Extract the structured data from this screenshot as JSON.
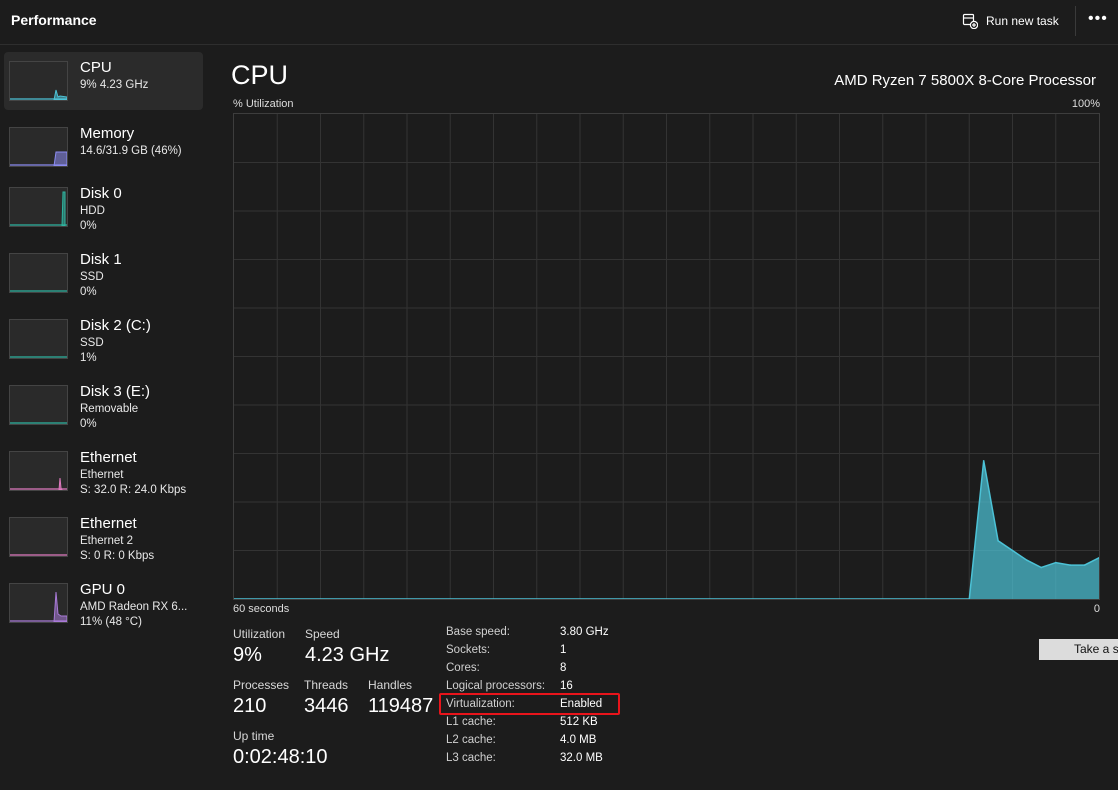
{
  "header": {
    "title": "Performance",
    "run_new_task_label": "Run new task",
    "more_label": "•••"
  },
  "sidebar": {
    "items": [
      {
        "name": "CPU",
        "line1": "9% 4.23 GHz",
        "line2": "",
        "color": "#4cc2d6",
        "selected": true
      },
      {
        "name": "Memory",
        "line1": "14.6/31.9 GB (46%)",
        "line2": "",
        "color": "#8b8bf0"
      },
      {
        "name": "Disk 0",
        "line1": "HDD",
        "line2": "0%",
        "color": "#2fb5a0"
      },
      {
        "name": "Disk 1",
        "line1": "SSD",
        "line2": "0%",
        "color": "#2fb5a0"
      },
      {
        "name": "Disk 2 (C:)",
        "line1": "SSD",
        "line2": "1%",
        "color": "#2fb5a0"
      },
      {
        "name": "Disk 3 (E:)",
        "line1": "Removable",
        "line2": "0%",
        "color": "#2fb5a0"
      },
      {
        "name": "Ethernet",
        "line1": "Ethernet",
        "line2": "S: 32.0  R: 24.0 Kbps",
        "color": "#e07ac0"
      },
      {
        "name": "Ethernet",
        "line1": "Ethernet 2",
        "line2": "S: 0  R: 0 Kbps",
        "color": "#e07ac0"
      },
      {
        "name": "GPU 0",
        "line1": "AMD Radeon RX 6...",
        "line2": "11%  (48 °C)",
        "color": "#a97ad8"
      }
    ]
  },
  "main": {
    "title": "CPU",
    "model": "AMD Ryzen 7 5800X 8-Core Processor",
    "graph_y_label": "% Utilization",
    "graph_y_max": "100%",
    "graph_x_label": "60 seconds",
    "graph_x_end": "0",
    "accent_color": "#4cc2d6"
  },
  "chart_data": {
    "type": "area",
    "ylim": [
      0,
      100
    ],
    "series": [
      {
        "x": [
          60,
          9,
          8,
          7,
          6,
          5,
          4,
          3,
          2,
          1,
          0
        ],
        "values": [
          0,
          0,
          28.5,
          12,
          10,
          8,
          6.5,
          7.5,
          7,
          7,
          8.5
        ]
      }
    ]
  },
  "stats": {
    "utilization_label": "Utilization",
    "utilization_value": "9%",
    "speed_label": "Speed",
    "speed_value": "4.23 GHz",
    "processes_label": "Processes",
    "processes_value": "210",
    "threads_label": "Threads",
    "threads_value": "3446",
    "handles_label": "Handles",
    "handles_value": "119487",
    "uptime_label": "Up time",
    "uptime_value": "0:02:48:10"
  },
  "details": [
    {
      "key": "Base speed:",
      "value": "3.80 GHz"
    },
    {
      "key": "Sockets:",
      "value": "1"
    },
    {
      "key": "Cores:",
      "value": "8"
    },
    {
      "key": "Logical processors:",
      "value": "16"
    },
    {
      "key": "Virtualization:",
      "value": "Enabled"
    },
    {
      "key": "L1 cache:",
      "value": "512 KB"
    },
    {
      "key": "L2 cache:",
      "value": "4.0 MB"
    },
    {
      "key": "L3 cache:",
      "value": "32.0 MB"
    }
  ],
  "screenshot_button_label": "Take a sc",
  "highlight_color": "#e8141b"
}
